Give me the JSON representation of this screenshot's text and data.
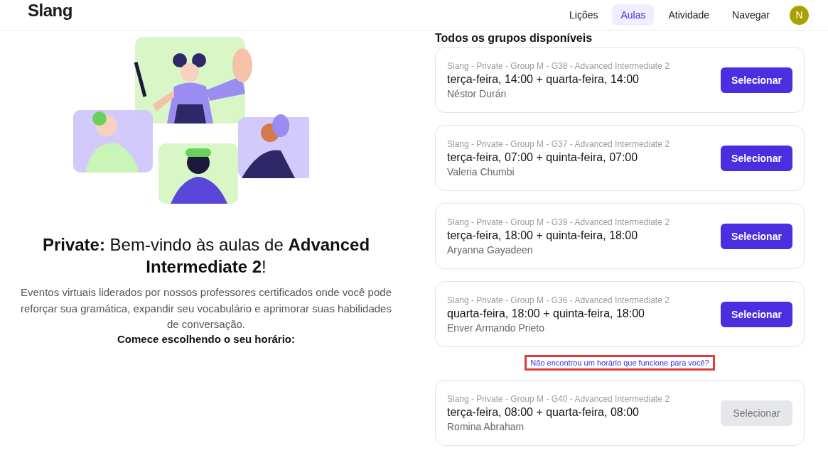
{
  "header": {
    "logo": "Slang",
    "nav": [
      {
        "label": "Lições",
        "selected": false
      },
      {
        "label": "Aulas",
        "selected": true
      },
      {
        "label": "Atividade",
        "selected": false
      },
      {
        "label": "Navegar",
        "selected": false
      }
    ],
    "avatar": "N"
  },
  "intro": {
    "title": "**Private:** Bem-vindo às aulas de **Advanced Intermediate 2**!",
    "description": "Eventos virtuais liderados por nossos professores certificados onde você pode reforçar sua gramática, expandir seu vocabulário e aprimorar suas habilidades de conversação.",
    "prompt": "Comece escolhendo o seu horário:"
  },
  "groups": {
    "heading": "Todos os grupos disponíveis",
    "items": [
      {
        "kind": "group",
        "name": "Slang - Private - Group M - G38 - Advanced Intermediate 2",
        "schedule": "terça-feira, 14:00 + quarta-feira, 14:00",
        "teacher": "Néstor Durán",
        "button": "Selecionar",
        "disabled": false
      },
      {
        "kind": "group",
        "name": "Slang - Private - Group M - G37 - Advanced Intermediate 2",
        "schedule": "terça-feira, 07:00 + quinta-feira, 07:00",
        "teacher": "Valeria Chumbi",
        "button": "Selecionar",
        "disabled": false
      },
      {
        "kind": "group",
        "name": "Slang - Private - Group M - G39 - Advanced Intermediate 2",
        "schedule": "terça-feira, 18:00 + quinta-feira, 18:00",
        "teacher": "Aryanna Gayadeen",
        "button": "Selecionar",
        "disabled": false
      },
      {
        "kind": "group",
        "name": "Slang - Private - Group M - G36 - Advanced Intermediate 2",
        "schedule": "quarta-feira, 18:00 + quinta-feira, 18:00",
        "teacher": "Enver Armando Prieto",
        "button": "Selecionar",
        "disabled": false
      },
      {
        "kind": "link",
        "text": "Não encontrou um horário que funcione para você?",
        "highlighted": true
      },
      {
        "kind": "group",
        "name": "Slang - Private - Group M - G40 - Advanced Intermediate 2",
        "schedule": "terça-feira, 08:00 + quarta-feira, 08:00",
        "teacher": "Romina Abraham",
        "button": "Selecionar",
        "disabled": true
      }
    ]
  }
}
